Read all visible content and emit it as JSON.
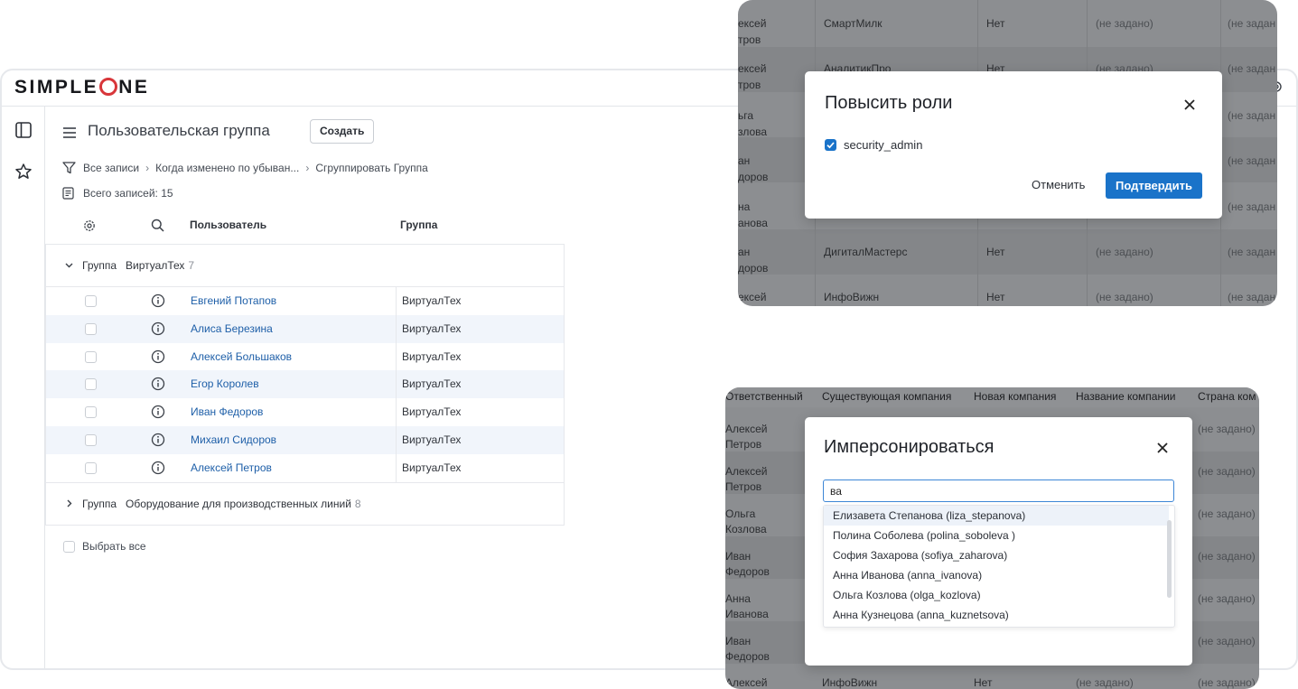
{
  "app": {
    "logo": "SIMPLEONE",
    "page_title": "Пользовательская группа",
    "create_label": "Создать",
    "breadcrumb": [
      "Все записи",
      "Когда изменено по убыван...",
      "Сгруппировать Группа"
    ],
    "records_label": "Всего записей: 15",
    "columns": {
      "user": "Пользователь",
      "group": "Группа"
    },
    "group_prefix": "Группа",
    "groups": [
      {
        "name": "ВиртуалТех",
        "count": "7",
        "expanded": true,
        "rows": [
          {
            "user": "Евгений Потапов",
            "group": "ВиртуалТех"
          },
          {
            "user": "Алиса Березина",
            "group": "ВиртуалТех"
          },
          {
            "user": "Алексей Большаков",
            "group": "ВиртуалТех"
          },
          {
            "user": "Егор Королев",
            "group": "ВиртуалТех"
          },
          {
            "user": "Иван Федоров",
            "group": "ВиртуалТех"
          },
          {
            "user": "Михаил Сидоров",
            "group": "ВиртуалТех"
          },
          {
            "user": "Алексей Петров",
            "group": "ВиртуалТех"
          }
        ]
      },
      {
        "name": "Оборудование для производственных линий",
        "count": "8",
        "expanded": false,
        "rows": []
      }
    ],
    "select_all_label": "Выбрать все"
  },
  "promote_panel": {
    "bg_rows": [
      {
        "name1": "ексей",
        "name2": "тров",
        "company": "СмартМилк",
        "flag": "Нет",
        "v1": "(не задано)",
        "v2": "(не задан"
      },
      {
        "name1": "ексей",
        "name2": "тров",
        "company": "АналитикПро",
        "flag": "Нет",
        "v1": "(не задано)",
        "v2": "(не задан"
      },
      {
        "name1": "ьга",
        "name2": "злова",
        "company": "",
        "flag": "",
        "v1": "",
        "v2": "(не задан"
      },
      {
        "name1": "ан",
        "name2": "доров",
        "company": "",
        "flag": "",
        "v1": "",
        "v2": "(не задан"
      },
      {
        "name1": "на",
        "name2": "анова",
        "company": "",
        "flag": "",
        "v1": "",
        "v2": "(не задан"
      },
      {
        "name1": "ан",
        "name2": "доров",
        "company": "ДигиталМастерс",
        "flag": "Нет",
        "v1": "(не задано)",
        "v2": "(не задан"
      },
      {
        "name1": "ексей",
        "name2": "",
        "company": "ИнфоВижн",
        "flag": "Нет",
        "v1": "(не задано)",
        "v2": "(не задан"
      }
    ],
    "modal": {
      "title": "Повысить роли",
      "role": "security_admin",
      "cancel_label": "Отменить",
      "confirm_label": "Подтвердить"
    }
  },
  "impersonate_panel": {
    "headers": [
      "Ответственный",
      "Существующая компания",
      "Новая компания",
      "Название компании",
      "Страна ком"
    ],
    "bg_rows": [
      {
        "name1": "Алексей",
        "name2": "Петров",
        "v": "(не задано)"
      },
      {
        "name1": "Алексей",
        "name2": "Петров",
        "v": "(не задано)"
      },
      {
        "name1": "Ольга",
        "name2": "Козлова",
        "v": "(не задано)"
      },
      {
        "name1": "Иван",
        "name2": "Федоров",
        "v": "(не задано)"
      },
      {
        "name1": "Анна",
        "name2": "Иванова",
        "v": "(не задано)"
      },
      {
        "name1": "Иван",
        "name2": "Федоров",
        "v": "(не задано)"
      }
    ],
    "last_row": {
      "name": "Алексей",
      "company": "ИнфоВижн",
      "flag": "Нет",
      "v1": "(не задано)",
      "v2": "(не задано)"
    },
    "modal": {
      "title": "Имперсонироваться",
      "search_value": "ва",
      "options": [
        "Елизавета Степанова (liza_stepanova)",
        "Полина Соболева (polina_soboleva )",
        "София Захарова (sofiya_zaharova)",
        "Анна Иванова (anna_ivanova)",
        "Ольга Козлова (olga_kozlova)",
        "Анна Кузнецова (anna_kuznetsova)"
      ]
    }
  },
  "colors": {
    "brand_red": "#d8363a",
    "link_blue": "#1e5fa8",
    "primary_button": "#1a73c9",
    "row_alt": "#f1f5fb",
    "overlay_gray": "#8c8e91"
  },
  "icons": [
    "sidebar-toggle-icon",
    "star-icon",
    "menu-icon",
    "filter-icon",
    "records-icon",
    "gear-icon",
    "search-icon",
    "info-icon",
    "chevron-down-icon",
    "chevron-right-icon",
    "close-icon",
    "checkbox-checked-icon"
  ]
}
